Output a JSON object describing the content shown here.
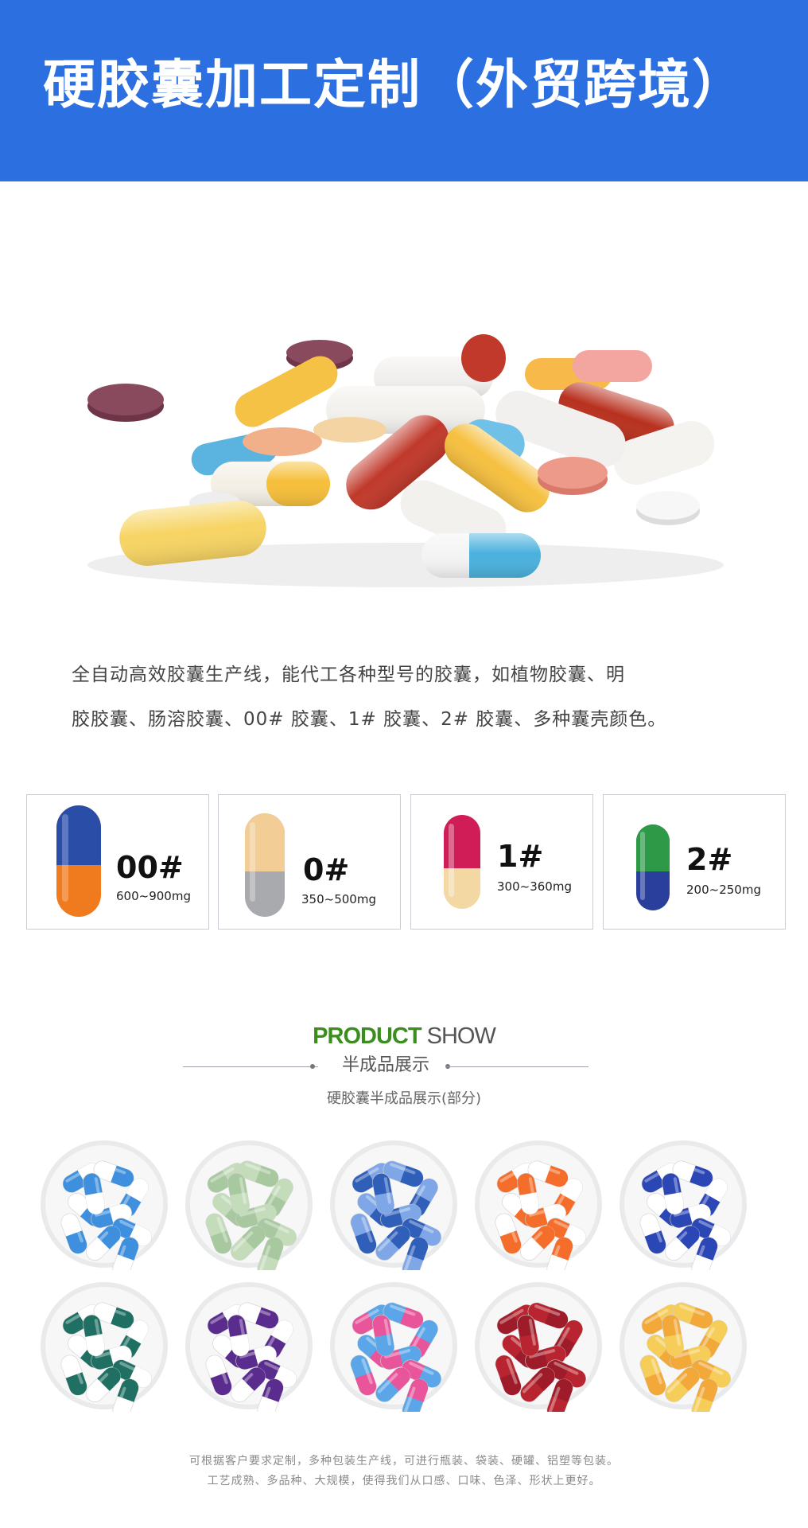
{
  "header": {
    "title": "硬胶囊加工定制（外贸跨境）"
  },
  "description": {
    "line1": "全自动高效胶囊生产线，能代工各种型号的胶囊，如植物胶囊、明",
    "line2": "胶胶囊、肠溶胶囊、00# 胶囊、1# 胶囊、2# 胶囊、多种囊壳颜色。"
  },
  "sizes": [
    {
      "size": "00#",
      "range": "600~900mg",
      "top_color": "#2a4da8",
      "bottom_color": "#f07a1e"
    },
    {
      "size": "0#",
      "range": "350~500mg",
      "top_color": "#f2cd95",
      "bottom_color": "#a9aaad"
    },
    {
      "size": "1#",
      "range": "300~360mg",
      "top_color": "#d01d57",
      "bottom_color": "#f3d8a3"
    },
    {
      "size": "2#",
      "range": "200~250mg",
      "top_color": "#2e9a48",
      "bottom_color": "#2a3f9c"
    }
  ],
  "product_show": {
    "title_en_bold": "PRODUCT",
    "title_en_light": "SHOW",
    "subtitle": "半成品展示",
    "caption": "硬胶囊半成品展示(部分)"
  },
  "bowls": [
    {
      "name": "blue-white",
      "a": "#3e8fde",
      "b": "#ffffff"
    },
    {
      "name": "sage-green",
      "a": "#a8c9a0",
      "b": "#c4dcba"
    },
    {
      "name": "blue-light-blue",
      "a": "#2f5fb8",
      "b": "#7fa6e6"
    },
    {
      "name": "orange-white",
      "a": "#f56d2a",
      "b": "#ffffff"
    },
    {
      "name": "navy-white",
      "a": "#2b46b5",
      "b": "#ffffff"
    },
    {
      "name": "teal-white",
      "a": "#1f6f63",
      "b": "#ffffff"
    },
    {
      "name": "purple-white",
      "a": "#5a2c8e",
      "b": "#ffffff"
    },
    {
      "name": "pink-blue",
      "a": "#e8559a",
      "b": "#5aa6e8"
    },
    {
      "name": "dark-red",
      "a": "#9e1c2a",
      "b": "#b8242f"
    },
    {
      "name": "yellow-orange",
      "a": "#f2a93a",
      "b": "#f6cd58"
    }
  ],
  "footer": {
    "line1": "可根据客户要求定制，多种包装生产线，可进行瓶装、袋装、硬罐、铝塑等包装。",
    "line2": "工艺成熟、多品种、大规模，使得我们从口感、口味、色泽、形状上更好。"
  },
  "colors": {
    "header_bg": "#2c6fe0",
    "product_green": "#3a8f1c"
  }
}
